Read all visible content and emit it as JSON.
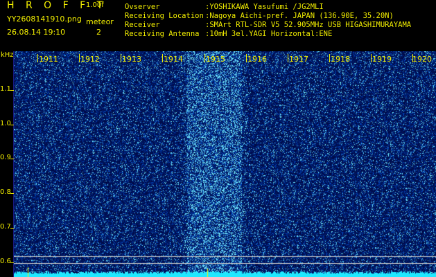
{
  "header": {
    "app_title": "H R O F F T",
    "version": "1.00f",
    "file_name": "YY2608141910.png",
    "meteor_label": "meteor",
    "date_time": "26.08.14 19:10",
    "meteor_count": "2"
  },
  "info": [
    {
      "key": "Ovserver",
      "value": ":YOSHIKAWA Yasufumi /JG2MLI"
    },
    {
      "key": "Receiving Location",
      "value": ":Nagoya Aichi-pref. JAPAN (136.90E, 35.20N)"
    },
    {
      "key": "Receiver",
      "value": ":SMArt RTL-SDR V5 52.905MHz USB HIGASHIMURAYAMA"
    },
    {
      "key": "Receiving Antenna",
      "value": ":10mH 3el.YAGI Horizontal:ENE"
    }
  ],
  "axis": {
    "y_unit": "kHz",
    "y_ticks": [
      "1.1",
      "1.0",
      "0.9",
      "0.8",
      "0.7",
      "0.6"
    ],
    "x_ticks": [
      "1911",
      "1912",
      "1913",
      "1914",
      "1915",
      "1916",
      "1917",
      "1918",
      "1919",
      "1920"
    ]
  },
  "colors": {
    "label": "#f4f000",
    "background": "#00005a",
    "signal": "#3a6cff",
    "noise_floor": "#20e0ff"
  }
}
